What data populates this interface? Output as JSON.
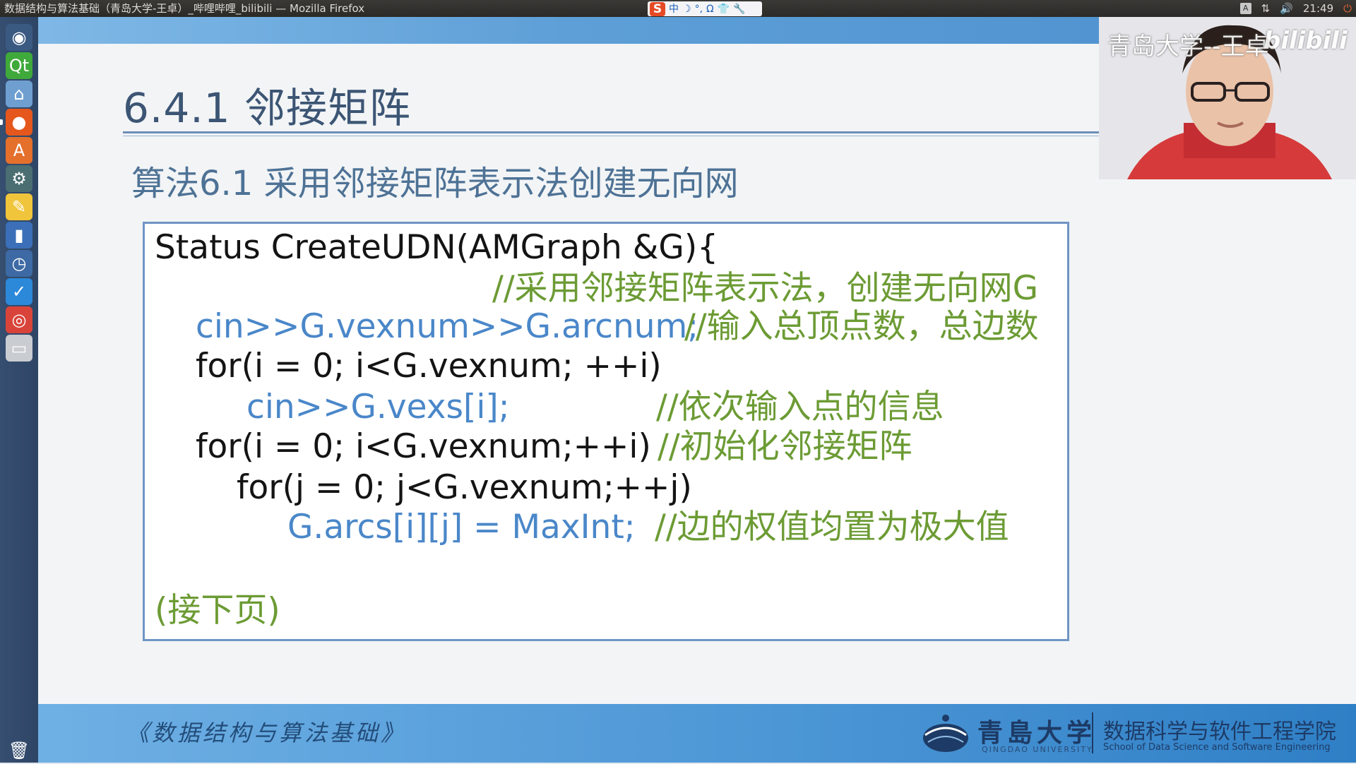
{
  "window": {
    "title": "数据结构与算法基础（青岛大学-王卓）_哔哩哔哩_bilibili — Mozilla Firefox"
  },
  "ime": {
    "logo": "S",
    "items": [
      "中",
      "☽",
      "°,",
      "Ω",
      "👕",
      "🔧"
    ]
  },
  "tray": {
    "keyboard": "A",
    "network": "⇅",
    "volume": "🔊",
    "time": "21:49",
    "power": "⏻"
  },
  "launcher": {
    "items": [
      {
        "name": "dash-icon",
        "glyph": "◉",
        "bg": "#3b5a82"
      },
      {
        "name": "qt-icon",
        "glyph": "Qt",
        "bg": "#40a93b"
      },
      {
        "name": "files-icon",
        "glyph": "⌂",
        "bg": "#6f9fd1"
      },
      {
        "name": "firefox-icon",
        "glyph": "●",
        "bg": "#e5571c"
      },
      {
        "name": "software-center-icon",
        "glyph": "A",
        "bg": "#e4702c"
      },
      {
        "name": "settings-icon",
        "glyph": "⚙",
        "bg": "#4a6e72"
      },
      {
        "name": "notes-icon",
        "glyph": "✎",
        "bg": "#f0c53b"
      },
      {
        "name": "stats-icon",
        "glyph": "▮",
        "bg": "#3b6fb8"
      },
      {
        "name": "clock-icon",
        "glyph": "◷",
        "bg": "#3d6aa4"
      },
      {
        "name": "editor-icon",
        "glyph": "✓",
        "bg": "#2c88d9"
      },
      {
        "name": "chrome-icon",
        "glyph": "◎",
        "bg": "#d9443a"
      },
      {
        "name": "drive-icon",
        "glyph": "▭",
        "bg": "#c9ccd0"
      },
      {
        "name": "trash-icon",
        "glyph": "🗑",
        "bg": "transparent"
      }
    ]
  },
  "slide": {
    "title": "6.4.1 邻接矩阵",
    "heading": "算法6.1 采用邻接矩阵表示法创建无向网",
    "code": [
      {
        "text": "Status CreateUDN(AMGraph &G){",
        "color": "black"
      },
      {
        "text": "//采用邻接矩阵表示法，创建无向网G",
        "color": "green"
      },
      {
        "text": "cin>>G.vexnum>>G.arcnum;",
        "color": "blue"
      },
      {
        "text": "//输入总顶点数，总边数",
        "color": "green"
      },
      {
        "text": "for(i = 0; i<G.vexnum; ++i)",
        "color": "black"
      },
      {
        "text": "cin>>G.vexs[i];",
        "color": "blue"
      },
      {
        "text": "//依次输入点的信息",
        "color": "green"
      },
      {
        "text": "for(i = 0; i<G.vexnum;++i)",
        "color": "black"
      },
      {
        "text": "//初始化邻接矩阵",
        "color": "green"
      },
      {
        "text": "for(j = 0; j<G.vexnum;++j)",
        "color": "black"
      },
      {
        "text": "G.arcs[i][j] = MaxInt;",
        "color": "blue"
      },
      {
        "text": "//边的权值均置为极大值",
        "color": "green"
      },
      {
        "text": "(接下页)",
        "color": "green"
      }
    ],
    "footer": {
      "course": "《数据结构与算法基础》",
      "university_cn": "青島大学",
      "university_en": "QINGDAO UNIVERSITY",
      "college_cn": "数据科学与软件工程学院",
      "college_en": "School of Data Science and Software Engineering"
    }
  },
  "webcam": {
    "watermark": "青岛大学--王卓",
    "brand": "bilibili"
  }
}
